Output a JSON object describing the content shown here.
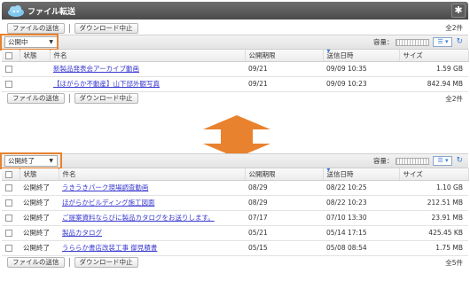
{
  "app": {
    "title": "ファイル転送"
  },
  "top": {
    "send_label": "ファイルの送信",
    "stop_label": "ダウンロード中止",
    "count": "全2件",
    "filter_value": "公開中",
    "capacity_label": "容量：",
    "columns": [
      "",
      "状態",
      "件名",
      "公開期限",
      "送信日時",
      "サイズ"
    ],
    "rows": [
      {
        "status": "",
        "subject": "新製品発表会アーカイブ動画",
        "deadline": "09/21",
        "sent": "09/09 10:35",
        "size": "1.59 GB"
      },
      {
        "status": "",
        "subject": "【ほがらか不動産】山下邸外観写真",
        "deadline": "09/21",
        "sent": "09/09 10:23",
        "size": "842.94 MB"
      }
    ]
  },
  "bottom": {
    "send_label": "ファイルの送信",
    "stop_label": "ダウンロード中止",
    "count": "全5件",
    "filter_value": "公開終了",
    "capacity_label": "容量：",
    "columns": [
      "",
      "状態",
      "件名",
      "公開期限",
      "送信日時",
      "サイズ"
    ],
    "rows": [
      {
        "status": "公開終了",
        "subject": "うきうきパーク現場調査動画",
        "deadline": "08/29",
        "sent": "08/22 10:25",
        "size": "1.10 GB"
      },
      {
        "status": "公開終了",
        "subject": "ほがらかビルディング施工図面",
        "deadline": "08/29",
        "sent": "08/22 10:23",
        "size": "212.51 MB"
      },
      {
        "status": "公開終了",
        "subject": "ご提案資料ならびに製品カタログをお送りします。",
        "deadline": "07/17",
        "sent": "07/10 13:30",
        "size": "23.91 MB"
      },
      {
        "status": "公開終了",
        "subject": "製品カタログ",
        "deadline": "05/21",
        "sent": "05/14 17:15",
        "size": "425.45 KB"
      },
      {
        "status": "公開終了",
        "subject": "うららか書店改装工事 御見積書",
        "deadline": "05/15",
        "sent": "05/08 08:54",
        "size": "1.75 MB"
      }
    ]
  },
  "colors": {
    "highlight": "#e8822e",
    "link": "#3a3ad0",
    "accent": "#3a7bd5"
  },
  "icons": {
    "gear": "gear-icon",
    "reload": "reload-icon",
    "logo": "cloud-logo-icon"
  }
}
